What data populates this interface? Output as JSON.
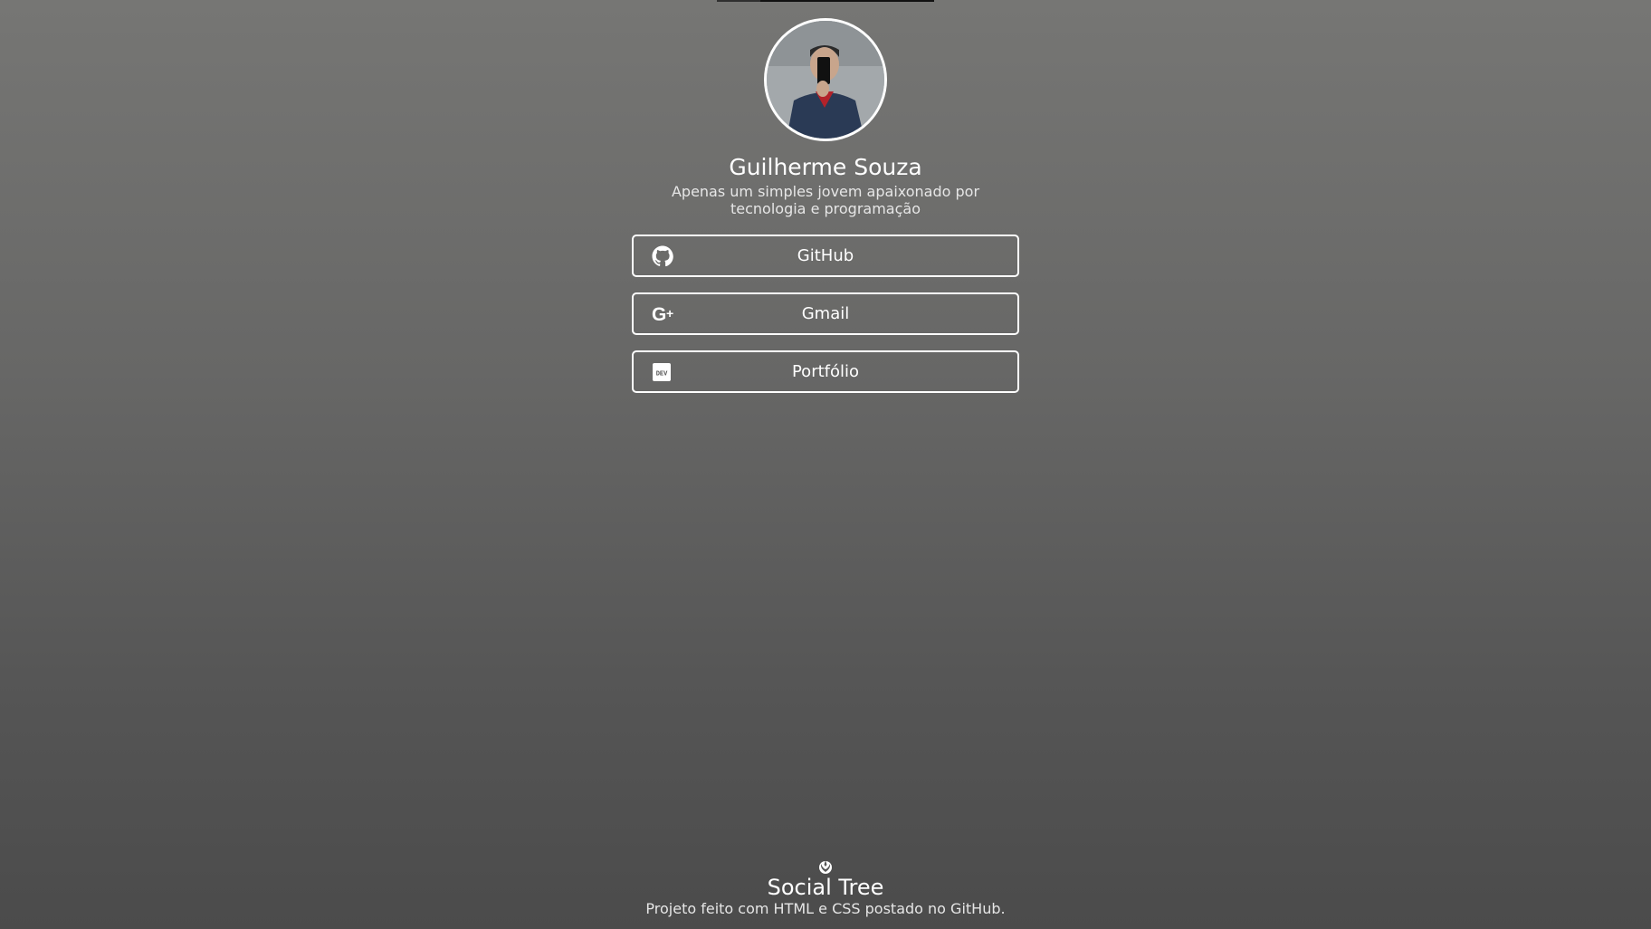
{
  "profile": {
    "avatar_alt": "avatar",
    "name": "Guilherme Souza",
    "bio": "Apenas um simples jovem apaixonado por tecnologia e programação"
  },
  "links": [
    {
      "label": "GitHub",
      "icon": "github-icon"
    },
    {
      "label": "Gmail",
      "icon": "google-plus-icon"
    },
    {
      "label": "Portfólio",
      "icon": "dev-icon"
    }
  ],
  "footer": {
    "icon": "rebel-icon",
    "title": "Social Tree",
    "text": "Projeto feito com HTML e CSS postado no GitHub."
  },
  "colors": {
    "text": "#ffffff",
    "border": "#ffffff",
    "background_top": "#767674",
    "background_bottom": "#4b4b4b"
  }
}
